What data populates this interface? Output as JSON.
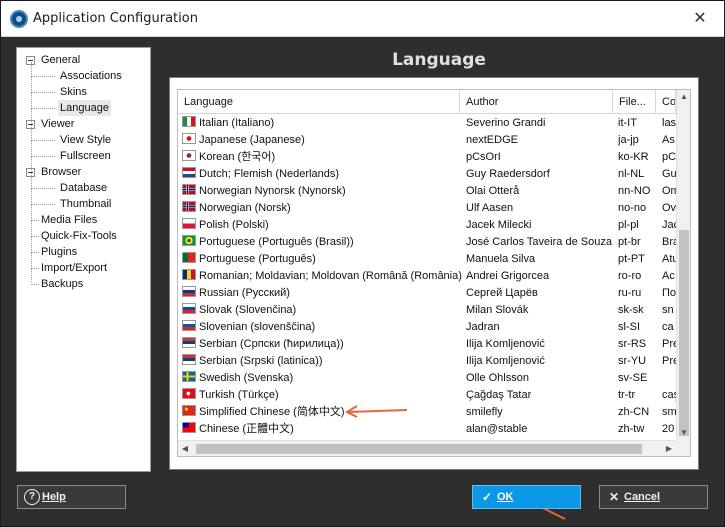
{
  "window": {
    "title": "Application Configuration",
    "close_glyph": "✕",
    "icon": "app-camera-icon"
  },
  "tree": {
    "nodes": [
      {
        "label": "General",
        "level": 0,
        "expander": true
      },
      {
        "label": "Associations",
        "level": 1
      },
      {
        "label": "Skins",
        "level": 1
      },
      {
        "label": "Language",
        "level": 1,
        "selected": true
      },
      {
        "label": "Viewer",
        "level": 0,
        "expander": true
      },
      {
        "label": "View Style",
        "level": 1
      },
      {
        "label": "Fullscreen",
        "level": 1
      },
      {
        "label": "Browser",
        "level": 0,
        "expander": true
      },
      {
        "label": "Database",
        "level": 1
      },
      {
        "label": "Thumbnail",
        "level": 1
      },
      {
        "label": "Media Files",
        "level": 0
      },
      {
        "label": "Quick-Fix-Tools",
        "level": 0
      },
      {
        "label": "Plugins",
        "level": 0
      },
      {
        "label": "Import/Export",
        "level": 0
      },
      {
        "label": "Backups",
        "level": 0
      }
    ]
  },
  "panel": {
    "title": "Language"
  },
  "table": {
    "columns": [
      "Language",
      "Author",
      "File...",
      "Co"
    ],
    "rows": [
      {
        "flag": "it",
        "language": "Italian (Italiano)",
        "author": "Severino Grandi",
        "file": "it-IT",
        "co": "las"
      },
      {
        "flag": "ja",
        "language": "Japanese (Japanese)",
        "author": "nextEDGE",
        "file": "ja-jp",
        "co": "As"
      },
      {
        "flag": "ko",
        "language": "Korean (한국어)",
        "author": "pCsOrI",
        "file": "ko-KR",
        "co": "pC"
      },
      {
        "flag": "nl",
        "language": "Dutch; Flemish (Nederlands)",
        "author": "Guy Raedersdorf",
        "file": "nl-NL",
        "co": "Gu"
      },
      {
        "flag": "no",
        "language": "Norwegian Nynorsk (Nynorsk)",
        "author": "Olai Otterå",
        "file": "nn-NO",
        "co": "Om"
      },
      {
        "flag": "no",
        "language": "Norwegian (Norsk)",
        "author": "Ulf Aasen",
        "file": "no-no",
        "co": "Ov"
      },
      {
        "flag": "pl",
        "language": "Polish (Polski)",
        "author": "Jacek Milecki",
        "file": "pl-pl",
        "co": "Jac"
      },
      {
        "flag": "br",
        "language": "Portuguese (Português (Brasil))",
        "author": "José Carlos Taveira de Souza",
        "file": "pt-br",
        "co": "Bra"
      },
      {
        "flag": "pt",
        "language": "Portuguese (Português)",
        "author": "Manuela Silva",
        "file": "pt-PT",
        "co": "Atu"
      },
      {
        "flag": "ro",
        "language": "Romanian; Moldavian; Moldovan (Română (România))",
        "author": "Andrei Grigorcea",
        "file": "ro-ro",
        "co": "Ac"
      },
      {
        "flag": "ru",
        "language": "Russian (Русский)",
        "author": "Сергей Царёв",
        "file": "ru-ru",
        "co": "По"
      },
      {
        "flag": "sk",
        "language": "Slovak (Slovenčina)",
        "author": "Milan Slovák",
        "file": "sk-sk",
        "co": "sn"
      },
      {
        "flag": "si",
        "language": "Slovenian (slovenščina)",
        "author": "Jadran",
        "file": "sl-SI",
        "co": "ca"
      },
      {
        "flag": "rs",
        "language": "Serbian (Српски (ћирилица))",
        "author": "Ilija Komljenović",
        "file": "sr-RS",
        "co": "Pre"
      },
      {
        "flag": "rs",
        "language": "Serbian (Srpski (latinica))",
        "author": "Ilija Komljenović",
        "file": "sr-YU",
        "co": "Pre"
      },
      {
        "flag": "se",
        "language": "Swedish (Svenska)",
        "author": "Olle Ohlsson",
        "file": "sv-SE",
        "co": ""
      },
      {
        "flag": "tr",
        "language": "Turkish (Türkçe)",
        "author": "Çağdaş Tatar",
        "file": "tr-tr",
        "co": "caş"
      },
      {
        "flag": "cn",
        "language": "Simplified Chinese (简体中文)",
        "author": "smilefly",
        "file": "zh-CN",
        "co": "sm"
      },
      {
        "flag": "tw",
        "language": "Chinese (正體中文)",
        "author": "alan@stable",
        "file": "zh-tw",
        "co": "20"
      }
    ]
  },
  "buttons": {
    "help": {
      "label": "Help",
      "icon": "?"
    },
    "ok": {
      "label": "OK",
      "icon": "✓"
    },
    "cancel": {
      "label": "Cancel",
      "icon": "✕"
    }
  },
  "colors": {
    "ok_button": "#0b98e6",
    "annotation_arrow": "#e8643c",
    "panel_background": "#2e2e2e"
  }
}
